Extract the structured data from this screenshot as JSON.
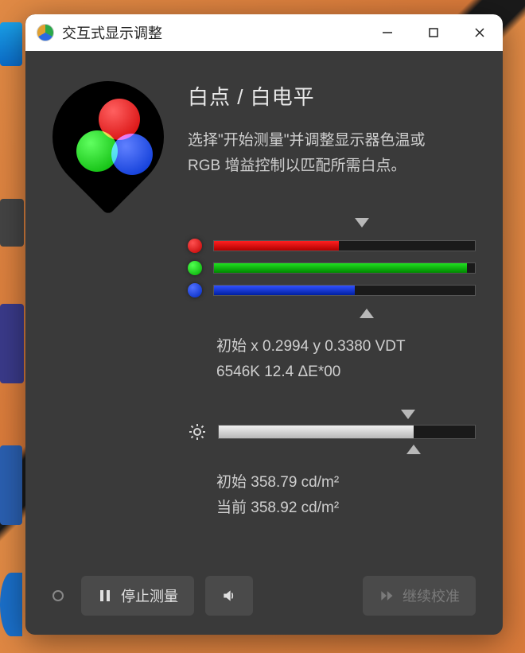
{
  "window": {
    "title": "交互式显示调整"
  },
  "header": {
    "title": "白点 / 白电平",
    "desc_line1": "选择\"开始测量\"并调整显示器色温或",
    "desc_line2": "RGB 增益控制以匹配所需白点。"
  },
  "rgb": {
    "red_pct": 48,
    "green_pct": 97,
    "blue_pct": 54,
    "target_marker_pct": 56,
    "current_marker_pct": 58
  },
  "whitepoint_readout": {
    "line1": "初始 x 0.2994 y 0.3380 VDT",
    "line2": "6546K 12.4 ΔE*00"
  },
  "brightness": {
    "value_pct": 76,
    "target_marker_pct": 74,
    "current_marker_pct": 76,
    "initial_label": "初始 358.79 cd/m²",
    "current_label": "当前 358.92 cd/m²"
  },
  "buttons": {
    "stop_measure": "停止测量",
    "continue_calibrate": "继续校准"
  }
}
